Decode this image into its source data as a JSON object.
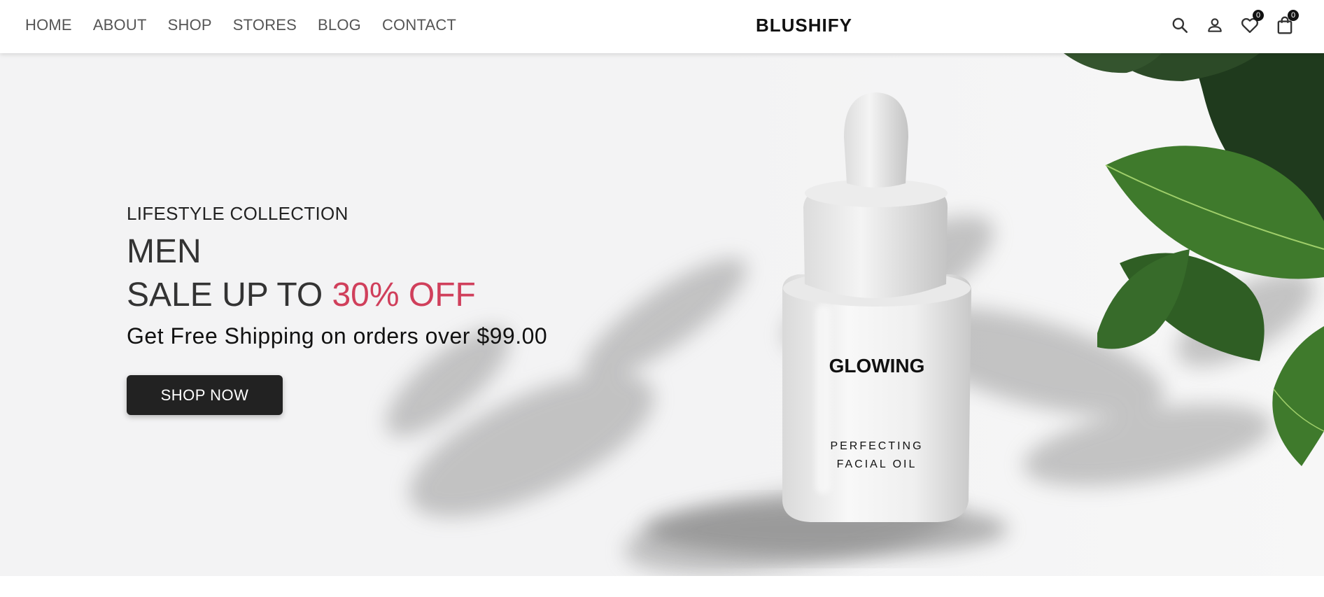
{
  "nav": {
    "items": [
      {
        "label": "HOME"
      },
      {
        "label": "ABOUT"
      },
      {
        "label": "SHOP"
      },
      {
        "label": "STORES"
      },
      {
        "label": "BLOG"
      },
      {
        "label": "CONTACT"
      }
    ]
  },
  "brand": {
    "name": "BLUSHIFY"
  },
  "header_icons": {
    "search": "search-icon",
    "account": "user-icon",
    "wishlist": {
      "icon": "heart-icon",
      "count": "0"
    },
    "cart": {
      "icon": "bag-icon",
      "count": "0"
    }
  },
  "hero": {
    "kicker": "LIFESTYLE COLLECTION",
    "title": "MEN",
    "sale_prefix": "SALE UP TO ",
    "sale_highlight": "30% OFF",
    "shipping": "Get Free Shipping on orders over $99.00",
    "cta_label": "SHOP NOW",
    "product": {
      "name": "GLOWING",
      "line1": "PERFECTING",
      "line2": "FACIAL OIL"
    }
  },
  "colors": {
    "accent": "#d03f5b",
    "button": "#222222",
    "hero_bg": "#f2f2f3"
  }
}
